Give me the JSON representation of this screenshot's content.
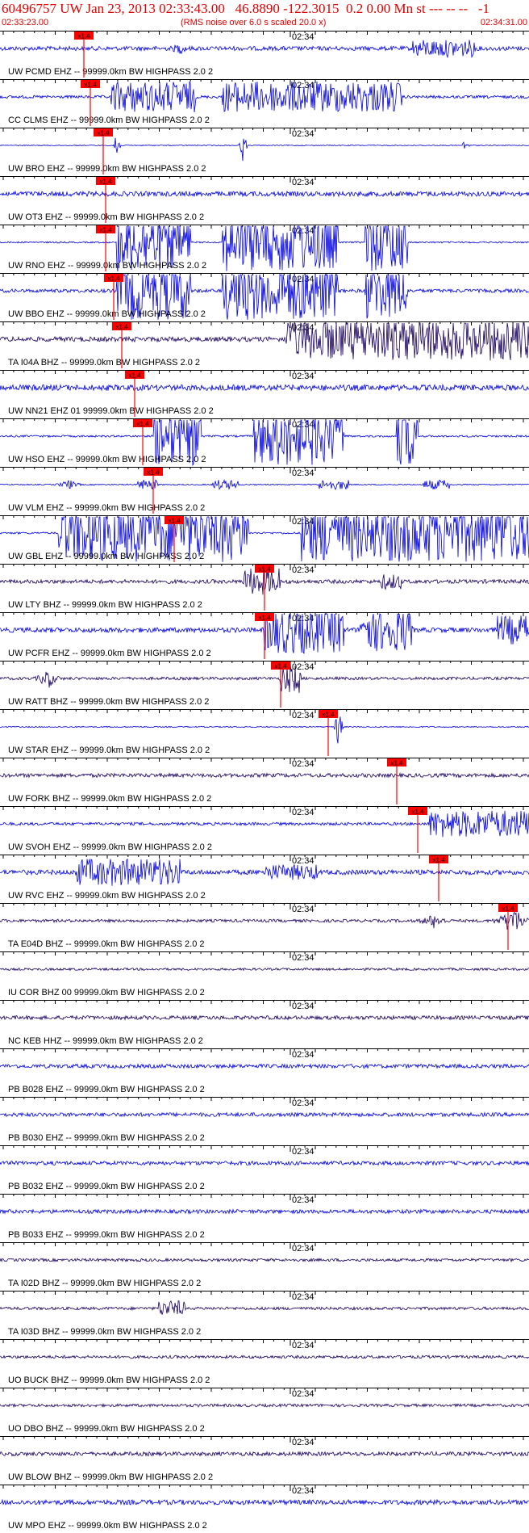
{
  "header": {
    "title": "60496757 UW Jan 23, 2013 02:33:43.00   46.8890 -122.3015  0.2 0.00 Mn st --- -- --   -1",
    "start_time": "02:33:23.00",
    "rms_note": "(RMS noise over 6.0 s scaled 20.0 x)",
    "end_time": "02:34:31.00"
  },
  "minute_mark": "02:34",
  "pick_label": "x1.4",
  "colors": {
    "header": "#e00000",
    "pick": "#ff0000",
    "blue": "#0000e0",
    "dark": "#1a0060"
  },
  "traces": [
    {
      "label": "UW PCMD EHZ -- 99999.0km BW  HIGHPASS  2.0  2",
      "color": "blue",
      "pick": 0.158,
      "amp": 0.22,
      "bursts": [
        [
          0.34,
          0.03,
          0.6
        ],
        [
          0.78,
          0.12,
          0.9
        ]
      ]
    },
    {
      "label": "CC CLMS EHZ -- 99999.0km BW  HIGHPASS  2.0  2",
      "color": "blue",
      "pick": 0.17,
      "amp": 0.15,
      "bursts": [
        [
          0.21,
          0.16,
          1.6
        ],
        [
          0.42,
          0.34,
          1.6
        ]
      ]
    },
    {
      "label": "UW BRO EHZ -- 99999.0km BW  HIGHPASS  2.0  2",
      "color": "blue",
      "pick": 0.195,
      "amp": 0.05,
      "bursts": [
        [
          0.22,
          0.005,
          3.0
        ],
        [
          0.46,
          0.005,
          2.5
        ],
        [
          0.88,
          0.005,
          1.2
        ]
      ]
    },
    {
      "label": "UW OT3 EHZ -- 99999.0km BW  HIGHPASS  2.0  2",
      "color": "blue",
      "pick": 0.2,
      "amp": 0.25,
      "bursts": []
    },
    {
      "label": "UW RNO EHZ -- 99999.0km BW  HIGHPASS  2.0  2",
      "color": "blue",
      "pick": 0.2,
      "amp": 0.08,
      "bursts": [
        [
          0.22,
          0.14,
          3.0
        ],
        [
          0.42,
          0.22,
          3.0
        ],
        [
          0.69,
          0.08,
          3.0
        ]
      ]
    },
    {
      "label": "UW BBO EHZ -- 99999.0km BW  HIGHPASS  2.0  2",
      "color": "blue",
      "pick": 0.215,
      "amp": 0.18,
      "bursts": [
        [
          0.22,
          0.14,
          3.0
        ],
        [
          0.42,
          0.22,
          3.0
        ],
        [
          0.69,
          0.08,
          3.0
        ]
      ]
    },
    {
      "label": "TA I04A BHZ -- 99999.0km BW  HIGHPASS  2.0  2",
      "color": "dark",
      "pick": 0.23,
      "amp": 0.25,
      "bursts": [
        [
          0.54,
          0.46,
          2.2
        ]
      ]
    },
    {
      "label": "UW NN21 EHZ 01 99999.0km BW  HIGHPASS  2.0  2",
      "color": "blue",
      "pick": 0.255,
      "amp": 0.3,
      "bursts": []
    },
    {
      "label": "UW HSO EHZ -- 99999.0km BW  HIGHPASS  2.0  2",
      "color": "blue",
      "pick": 0.27,
      "amp": 0.1,
      "bursts": [
        [
          0.29,
          0.09,
          3.0
        ],
        [
          0.48,
          0.17,
          3.0
        ],
        [
          0.75,
          0.04,
          3.0
        ]
      ]
    },
    {
      "label": "UW VLM EHZ -- 99999.0km BW  HIGHPASS  2.0  2",
      "color": "blue",
      "pick": 0.29,
      "amp": 0.06,
      "bursts": [
        [
          0.13,
          0.02,
          0.6
        ],
        [
          0.26,
          0.04,
          0.5
        ],
        [
          0.4,
          0.05,
          0.5
        ],
        [
          0.6,
          0.06,
          0.5
        ],
        [
          0.8,
          0.05,
          0.5
        ]
      ]
    },
    {
      "label": "UW GBL EHZ -- 99999.0km BW  HIGHPASS  2.0  2",
      "color": "blue",
      "pick": 0.33,
      "amp": 0.1,
      "bursts": [
        [
          0.11,
          0.36,
          3.0
        ],
        [
          0.57,
          0.43,
          3.0
        ]
      ]
    },
    {
      "label": "UW LTY BHZ -- 99999.0km BW  HIGHPASS  2.0  2",
      "color": "dark",
      "pick": 0.5,
      "amp": 0.2,
      "bursts": [
        [
          0.46,
          0.07,
          1.4
        ],
        [
          0.72,
          0.04,
          0.8
        ]
      ]
    },
    {
      "label": "UW PCFR EHZ -- 99999.0km BW  HIGHPASS  2.0  2",
      "color": "blue",
      "pick": 0.5,
      "amp": 0.25,
      "bursts": [
        [
          0.5,
          0.15,
          2.4
        ],
        [
          0.68,
          0.1,
          2.2
        ],
        [
          0.94,
          0.06,
          1.5
        ]
      ]
    },
    {
      "label": "UW RATT BHZ -- 99999.0km BW  HIGHPASS  2.0  2",
      "color": "dark",
      "pick": 0.53,
      "amp": 0.15,
      "bursts": [
        [
          0.09,
          0.02,
          1.2
        ],
        [
          0.53,
          0.04,
          1.5
        ]
      ]
    },
    {
      "label": "UW STAR EHZ -- 99999.0km BW  HIGHPASS  2.0  2",
      "color": "blue",
      "pick": 0.62,
      "amp": 0.06,
      "bursts": [
        [
          0.64,
          0.006,
          3.0
        ]
      ]
    },
    {
      "label": "UW FORK BHZ -- 99999.0km BW  HIGHPASS  2.0  2",
      "color": "dark",
      "pick": 0.75,
      "amp": 0.2,
      "bursts": []
    },
    {
      "label": "UW SVOH EHZ -- 99999.0km BW  HIGHPASS  2.0  2",
      "color": "blue",
      "pick": 0.79,
      "amp": 0.15,
      "bursts": [
        [
          0.81,
          0.19,
          1.4
        ]
      ]
    },
    {
      "label": "UW RVC EHZ -- 99999.0km BW  HIGHPASS  2.0  2",
      "color": "blue",
      "pick": 0.83,
      "amp": 0.25,
      "bursts": [
        [
          0.14,
          0.2,
          1.4
        ],
        [
          0.5,
          0.1,
          0.8
        ]
      ]
    },
    {
      "label": "TA E04D BHZ -- 99999.0km BW  HIGHPASS  2.0  2",
      "color": "dark",
      "pick": 0.96,
      "amp": 0.15,
      "bursts": [
        [
          0.82,
          0.03,
          0.8
        ],
        [
          0.97,
          0.03,
          1.6
        ]
      ]
    },
    {
      "label": "IU COR BHZ 00 99999.0km BW  HIGHPASS  2.0  2",
      "color": "dark",
      "pick": null,
      "amp": 0.12,
      "bursts": []
    },
    {
      "label": "NC KEB HHZ -- 99999.0km BW  HIGHPASS  2.0  2",
      "color": "dark",
      "pick": null,
      "amp": 0.2,
      "bursts": []
    },
    {
      "label": "PB B028 EHZ -- 99999.0km BW  HIGHPASS  2.0  2",
      "color": "blue",
      "pick": null,
      "amp": 0.2,
      "bursts": []
    },
    {
      "label": "PB B030 EHZ -- 99999.0km BW  HIGHPASS  2.0  2",
      "color": "blue",
      "pick": null,
      "amp": 0.2,
      "bursts": []
    },
    {
      "label": "PB B032 EHZ -- 99999.0km BW  HIGHPASS  2.0  2",
      "color": "blue",
      "pick": null,
      "amp": 0.2,
      "bursts": []
    },
    {
      "label": "PB B033 EHZ -- 99999.0km BW  HIGHPASS  2.0  2",
      "color": "blue",
      "pick": null,
      "amp": 0.2,
      "bursts": []
    },
    {
      "label": "TA I02D BHZ -- 99999.0km BW  HIGHPASS  2.0  2",
      "color": "dark",
      "pick": null,
      "amp": 0.15,
      "bursts": []
    },
    {
      "label": "TA I03D BHZ -- 99999.0km BW  HIGHPASS  2.0  2",
      "color": "dark",
      "pick": null,
      "amp": 0.15,
      "bursts": [
        [
          0.3,
          0.05,
          0.8
        ]
      ]
    },
    {
      "label": "UO BUCK BHZ -- 99999.0km BW  HIGHPASS  2.0  2",
      "color": "dark",
      "pick": null,
      "amp": 0.15,
      "bursts": []
    },
    {
      "label": "UO DBO BHZ -- 99999.0km BW  HIGHPASS  2.0  2",
      "color": "dark",
      "pick": null,
      "amp": 0.15,
      "bursts": []
    },
    {
      "label": "UW BLOW BHZ -- 99999.0km BW  HIGHPASS  2.0  2",
      "color": "dark",
      "pick": null,
      "amp": 0.2,
      "bursts": []
    },
    {
      "label": "UW MPO EHZ -- 99999.0km BW  HIGHPASS  2.0  2",
      "color": "blue",
      "pick": null,
      "amp": 0.25,
      "bursts": []
    }
  ]
}
